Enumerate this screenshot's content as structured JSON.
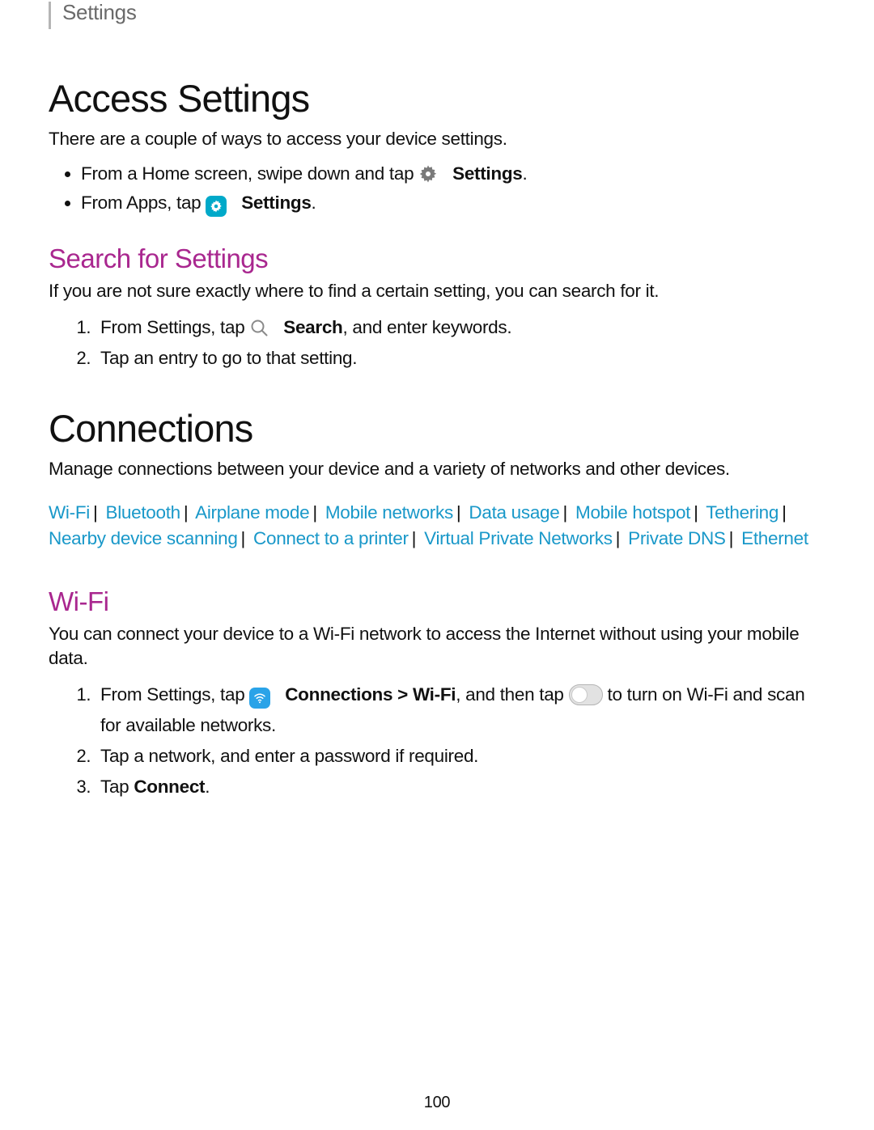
{
  "header": {
    "breadcrumb": "Settings"
  },
  "section1": {
    "title": "Access Settings",
    "intro": "There are a couple of ways to access your device settings.",
    "bullet1_prefix": "From a Home screen, swipe down and tap ",
    "bullet1_bold": "Settings",
    "bullet1_suffix": ".",
    "bullet2_prefix": "From Apps, tap ",
    "bullet2_bold": "Settings",
    "bullet2_suffix": "."
  },
  "search": {
    "title": "Search for Settings",
    "intro": "If you are not sure exactly where to find a certain setting, you can search for it.",
    "step1_prefix": "From Settings, tap ",
    "step1_bold": "Search",
    "step1_suffix": ", and enter keywords.",
    "step2": "Tap an entry to go to that setting."
  },
  "connections": {
    "title": "Connections",
    "intro": "Manage connections between your device and a variety of networks and other devices.",
    "links": [
      "Wi-Fi",
      "Bluetooth",
      "Airplane mode",
      "Mobile networks",
      "Data usage",
      "Mobile hotspot",
      "Tethering",
      "Nearby device scanning",
      "Connect to a printer",
      "Virtual Private Networks",
      "Private DNS",
      "Ethernet"
    ]
  },
  "wifi": {
    "title": "Wi-Fi",
    "intro": "You can connect your device to a Wi-Fi network to access the Internet without using your mobile data.",
    "step1_prefix": "From Settings, tap ",
    "step1_bold1": "Connections",
    "step1_mid": " > ",
    "step1_bold2": "Wi-Fi",
    "step1_mid2": ", and then tap ",
    "step1_suffix": " to turn on Wi-Fi and scan for available networks.",
    "step2": "Tap a network, and enter a password if required.",
    "step3_prefix": "Tap ",
    "step3_bold": "Connect",
    "step3_suffix": "."
  },
  "pageNumber": "100"
}
